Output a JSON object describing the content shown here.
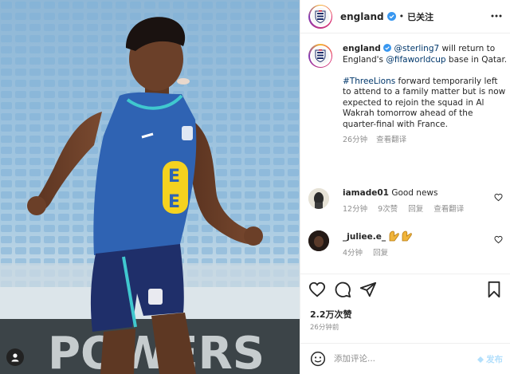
{
  "post": {
    "account": "england",
    "follow_separator": "•",
    "follow_status": "已关注",
    "caption": {
      "username": "england",
      "mention": "@sterling7",
      "text_1": " will return to England's ",
      "mention_2": "@fifaworldcup",
      "text_2": " base in Qatar.",
      "hashtag": "#ThreeLions",
      "text_3": " forward temporarily left to attend to a family matter but is now expected to rejoin the squad in Al Wakrah tomorrow ahead of the quarter-final with France.",
      "age": "26分钟",
      "translate": "查看翻译"
    },
    "comments": [
      {
        "username": "iamade01",
        "text": "Good news",
        "age": "12分钟",
        "likes": "9次赞",
        "reply": "回复",
        "translate": "查看翻译"
      },
      {
        "username": "_juliee.e_",
        "text": "",
        "age": "4分钟",
        "reply": "回复"
      }
    ],
    "likes": "2.2万次赞",
    "timestamp": "26分钟前",
    "comment_placeholder": "添加评论...",
    "post_label": "发布",
    "shirt_sponsor_letter": "E"
  },
  "colors": {
    "verified": "#3897f0",
    "link": "#00376b",
    "shirt_blue": "#2f63b3",
    "sponsor_yellow": "#f5d21f",
    "shorts_navy": "#1f2f6a",
    "trim_teal": "#40c8cf"
  },
  "icons": {
    "verified": "verified-badge-icon",
    "more": "more-options-icon",
    "like": "heart-icon",
    "comment": "comment-icon",
    "share": "paper-plane-icon",
    "save": "bookmark-icon",
    "emoji": "emoji-icon",
    "tagged_user": "person-icon"
  }
}
